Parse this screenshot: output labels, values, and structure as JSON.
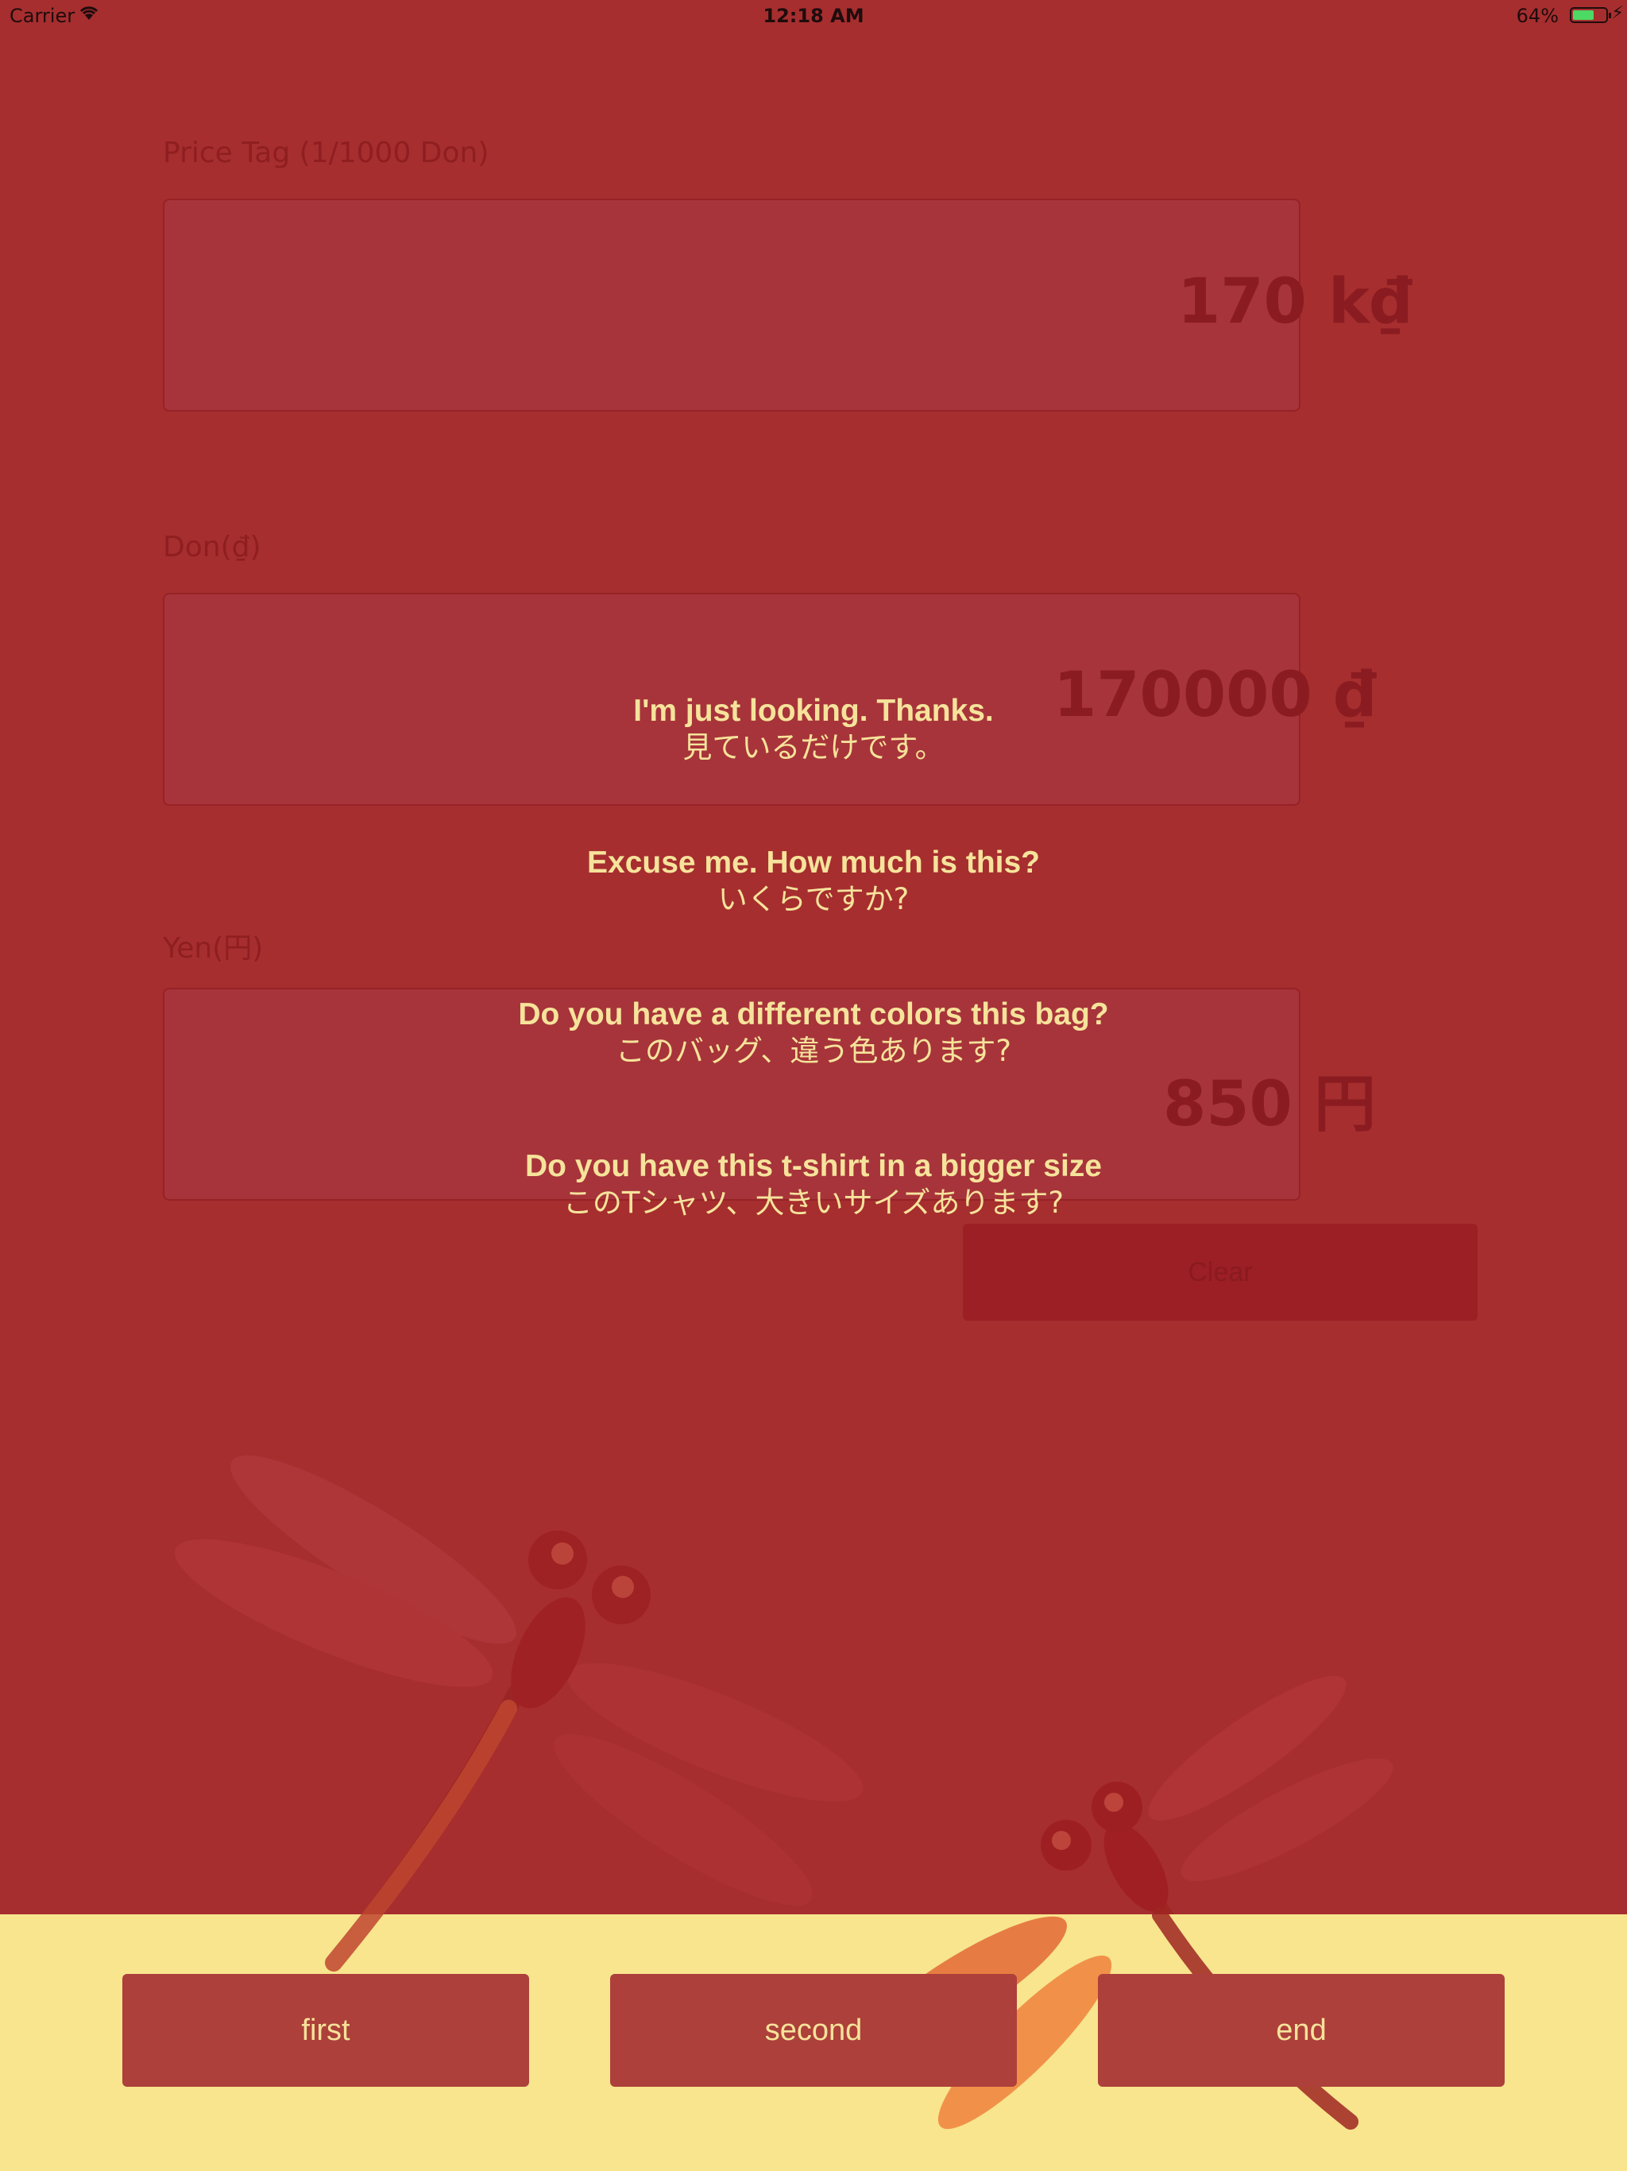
{
  "status_bar": {
    "carrier": "Carrier",
    "time": "12:18 AM",
    "battery_percent": "64%",
    "battery_level": 0.64
  },
  "fields": {
    "price_tag": {
      "label": "Price Tag (1/1000 Don)",
      "value": "170 k₫"
    },
    "don": {
      "label": "Don(₫)",
      "value": "170000 ₫"
    },
    "yen": {
      "label": "Yen(円)",
      "value": "850 円"
    }
  },
  "clear_button": {
    "label": "Clear"
  },
  "phrases": [
    {
      "en": "I'm just looking. Thanks.",
      "ja": "見ているだけです。"
    },
    {
      "en": "Excuse me. How much is this?",
      "ja": "いくらですか?"
    },
    {
      "en": "Do you have a different colors this bag?",
      "ja": "このバッグ、違う色あります?"
    },
    {
      "en": "Do you have this t-shirt in a bigger size",
      "ja": "このTシャツ、大きいサイズあります?"
    }
  ],
  "nav": {
    "first": "first",
    "second": "second",
    "end": "end"
  },
  "colors": {
    "background": "#a62e2f",
    "bottom_panel": "#f8e58e",
    "phrase_text": "#f6e39b",
    "nav_button": "#ad403a"
  },
  "icons": {
    "wifi": "wifi-icon",
    "battery": "battery-icon",
    "charging": "charging-bolt-icon",
    "decoration": "dragonfly-icon"
  }
}
